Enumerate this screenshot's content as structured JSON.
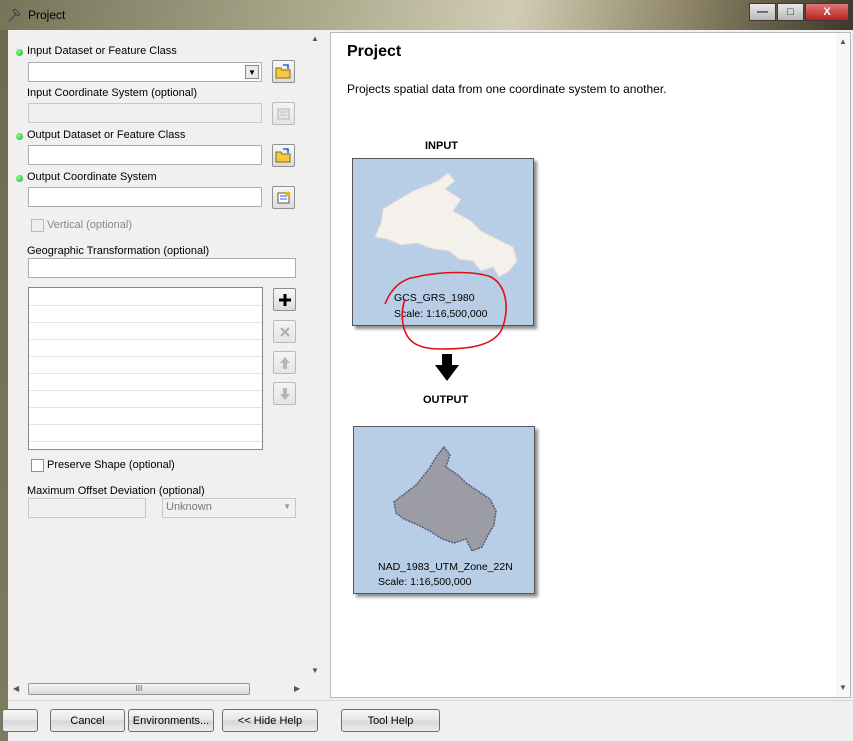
{
  "window": {
    "title": "Project",
    "minimize": "—",
    "maximize": "□",
    "close": "X"
  },
  "form": {
    "input_dataset": {
      "label": "Input Dataset or Feature Class",
      "value": ""
    },
    "input_coord": {
      "label": "Input Coordinate System (optional)",
      "value": ""
    },
    "output_dataset": {
      "label": "Output Dataset or Feature Class",
      "value": ""
    },
    "output_coord": {
      "label": "Output Coordinate System",
      "value": ""
    },
    "vertical": {
      "label": "Vertical (optional)"
    },
    "geo_transform": {
      "label": "Geographic Transformation (optional)",
      "value": ""
    },
    "preserve_shape": {
      "label": "Preserve Shape (optional)"
    },
    "max_offset": {
      "label": "Maximum Offset Deviation (optional)",
      "value": "",
      "unit": "Unknown"
    }
  },
  "help": {
    "title": "Project",
    "description": "Projects spatial data from one coordinate system to another.",
    "input_caption": "INPUT",
    "input_crs": "GCS_GRS_1980",
    "input_scale": "Scale: 1:16,500,000",
    "output_caption": "OUTPUT",
    "output_crs": "NAD_1983_UTM_Zone_22N",
    "output_scale": "Scale: 1:16,500,000"
  },
  "buttons": {
    "cancel": "Cancel",
    "environments": "Environments...",
    "hide_help": "<< Hide Help",
    "tool_help": "Tool Help"
  },
  "scroll": {
    "hthumb": "III"
  }
}
